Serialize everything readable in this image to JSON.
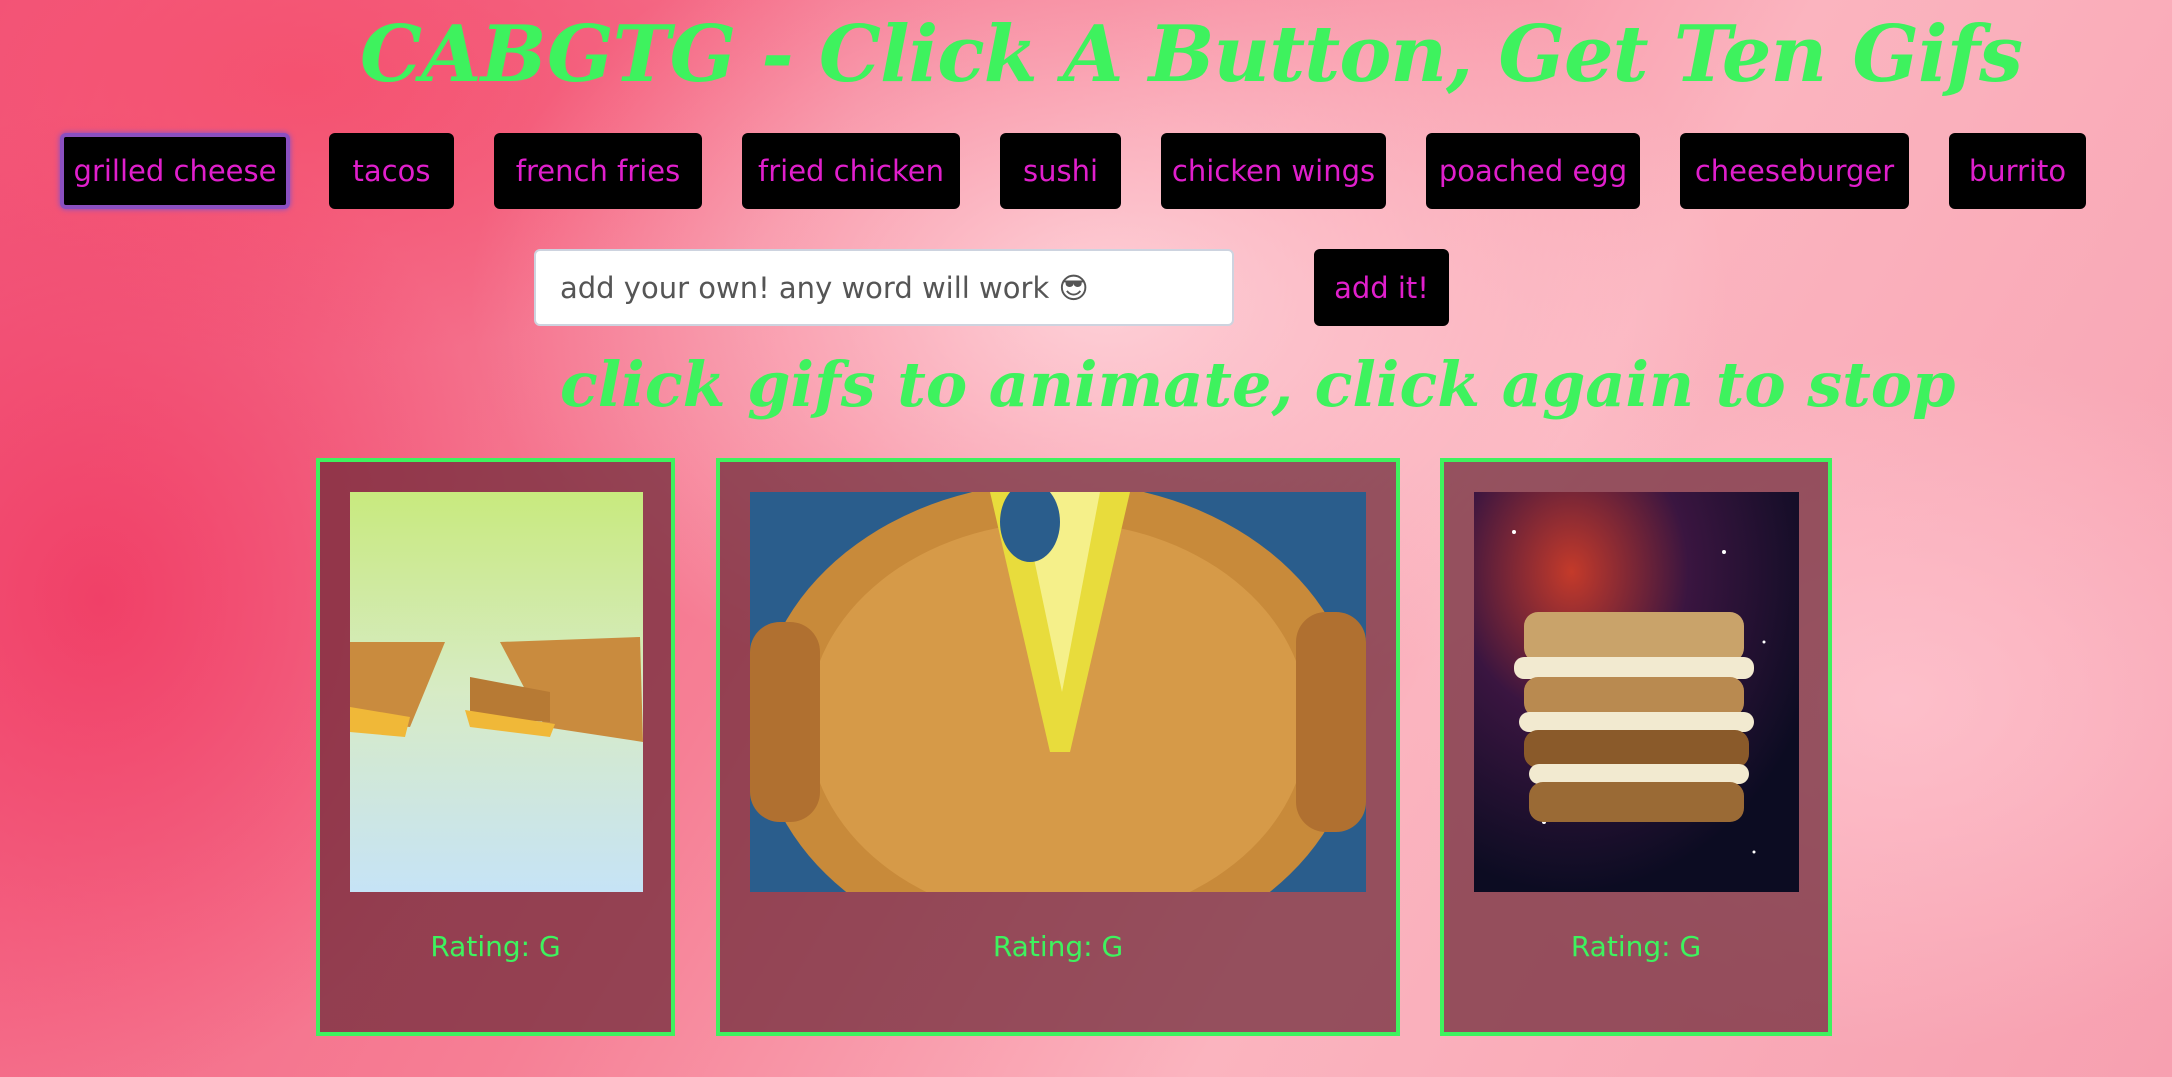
{
  "title": "CABGTG - Click A Button, Get Ten Gifs",
  "topic_buttons": [
    {
      "label": "grilled cheese"
    },
    {
      "label": "tacos"
    },
    {
      "label": "french fries"
    },
    {
      "label": "fried chicken"
    },
    {
      "label": "sushi"
    },
    {
      "label": "chicken wings"
    },
    {
      "label": "poached egg"
    },
    {
      "label": "cheeseburger"
    },
    {
      "label": "burrito"
    }
  ],
  "add_form": {
    "placeholder": "add your own! any word will work 😎",
    "value": "",
    "submit_label": "add it!"
  },
  "instructions": "click gifs to animate, click again to stop",
  "gifs": [
    {
      "rating": "Rating: G",
      "description": "grilled cheese halves"
    },
    {
      "rating": "Rating: G",
      "description": "hands pulling grilled cheese"
    },
    {
      "rating": "Rating: G",
      "description": "stacked grilled cheese in space"
    }
  ],
  "colors": {
    "accent_green": "#3ef25e",
    "button_text_magenta": "#e01fcc",
    "button_bg": "#000000"
  }
}
